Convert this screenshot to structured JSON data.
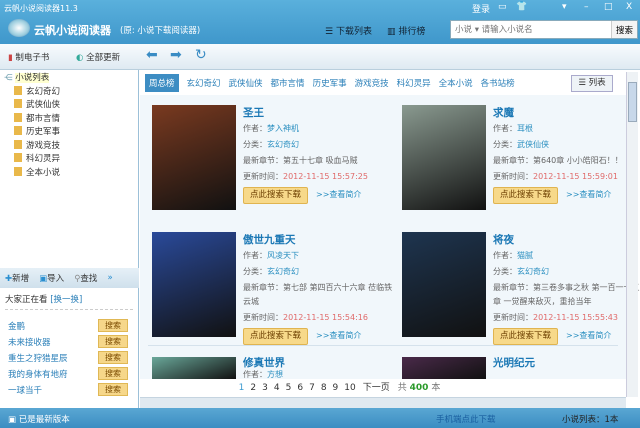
{
  "window": {
    "title": "云帆小说阅读器11.3",
    "login": "登录",
    "min": "–",
    "max": "□",
    "close": "X"
  },
  "header": {
    "app_name": "云帆小说阅读器",
    "app_sub": "(原: 小说下载阅读器)",
    "download_list": "下载列表",
    "ranking": "排行榜",
    "search_placeholder": "小说 ▾ 请输入小说名",
    "search_button": "搜索"
  },
  "toolbar": {
    "make_ebook": "制电子书",
    "update_all": "全部更新"
  },
  "sidebar": {
    "root": "小说列表",
    "folders": [
      "玄幻奇幻",
      "武侠仙侠",
      "都市言情",
      "历史军事",
      "游戏竞技",
      "科幻灵异",
      "全本小说"
    ],
    "actions": {
      "add": "新增",
      "import": "导入",
      "find": "查找"
    },
    "watching": "大家正在看",
    "refresh": "[换一换]",
    "watch_list": [
      "金鹏",
      "未来接收器",
      "重生之狩猎星辰",
      "我的身体有地府",
      "一球当千"
    ],
    "search_btn": "搜索",
    "status": "已是最新版本"
  },
  "tabs": [
    "周总榜",
    "玄幻奇幻",
    "武侠仙侠",
    "都市言情",
    "历史军事",
    "游戏竞技",
    "科幻灵异",
    "全本小说",
    "各书站榜"
  ],
  "view": {
    "list": "列表"
  },
  "labels": {
    "author": "作者：",
    "category": "分类：",
    "latest": "最新章节：",
    "updated": "更新时间：",
    "download": "点此搜索下载",
    "intro": ">>查看简介"
  },
  "books": [
    {
      "title": "圣王",
      "author": "梦入神机",
      "category": "玄幻奇幻",
      "latest": "第五十七章 吸血马贼",
      "time": "2012-11-15 15:57:25",
      "color": "#7a3a20"
    },
    {
      "title": "求魔",
      "author": "耳根",
      "category": "武侠仙侠",
      "latest": "第640章 小小皓阳石！！",
      "time": "2012-11-15 15:59:01",
      "color": "#8a9a90"
    },
    {
      "title": "傲世九重天",
      "author": "风凌天下",
      "category": "玄幻奇幻",
      "latest": "第七部 第四百六十六章 莅临铁云城",
      "time": "2012-11-15 15:54:16",
      "color": "#2a4a9a"
    },
    {
      "title": "将夜",
      "author": "猫腻",
      "category": "玄幻奇幻",
      "latest": "第三卷多事之秋 第一百一十五章 一觉醒来敌灭，重拾当年",
      "time": "2012-11-15 15:55:43",
      "color": "#1e3550"
    },
    {
      "title": "修真世界",
      "author": "方想",
      "color": "#6aa89a"
    },
    {
      "title": "光明纪元",
      "author": "",
      "color": "#4a2a4a"
    }
  ],
  "pager": {
    "pages": [
      "1",
      "2",
      "3",
      "4",
      "5",
      "6",
      "7",
      "8",
      "9",
      "10"
    ],
    "next": "下一页",
    "total_prefix": "共",
    "total": "400",
    "total_suffix": "本"
  },
  "status": {
    "mobile": "手机端点此下载",
    "list_count": "小说列表：1本"
  }
}
